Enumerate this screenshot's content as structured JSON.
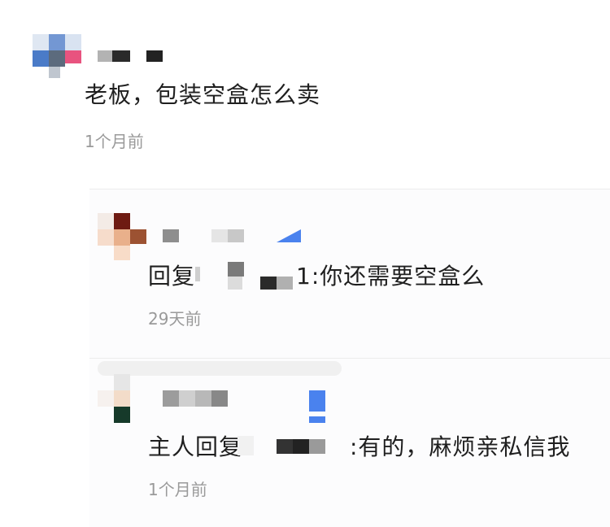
{
  "comments": [
    {
      "text": "老板，包装空盒怎么卖",
      "time": "1个月前"
    }
  ],
  "replies": [
    {
      "prefix": "回复",
      "text": "1:你还需要空盒么",
      "time": "29天前"
    },
    {
      "prefix": "主人回复",
      "text": ":有的，麻烦亲私信我",
      "time": "1个月前"
    }
  ],
  "colors": {
    "avatar_blue": "#4a7bc8",
    "avatar_pink": "#e8537f",
    "accent_blue": "#4a82ee",
    "time_gray": "#9a9a9a",
    "text_dark": "#1f1f1f"
  }
}
